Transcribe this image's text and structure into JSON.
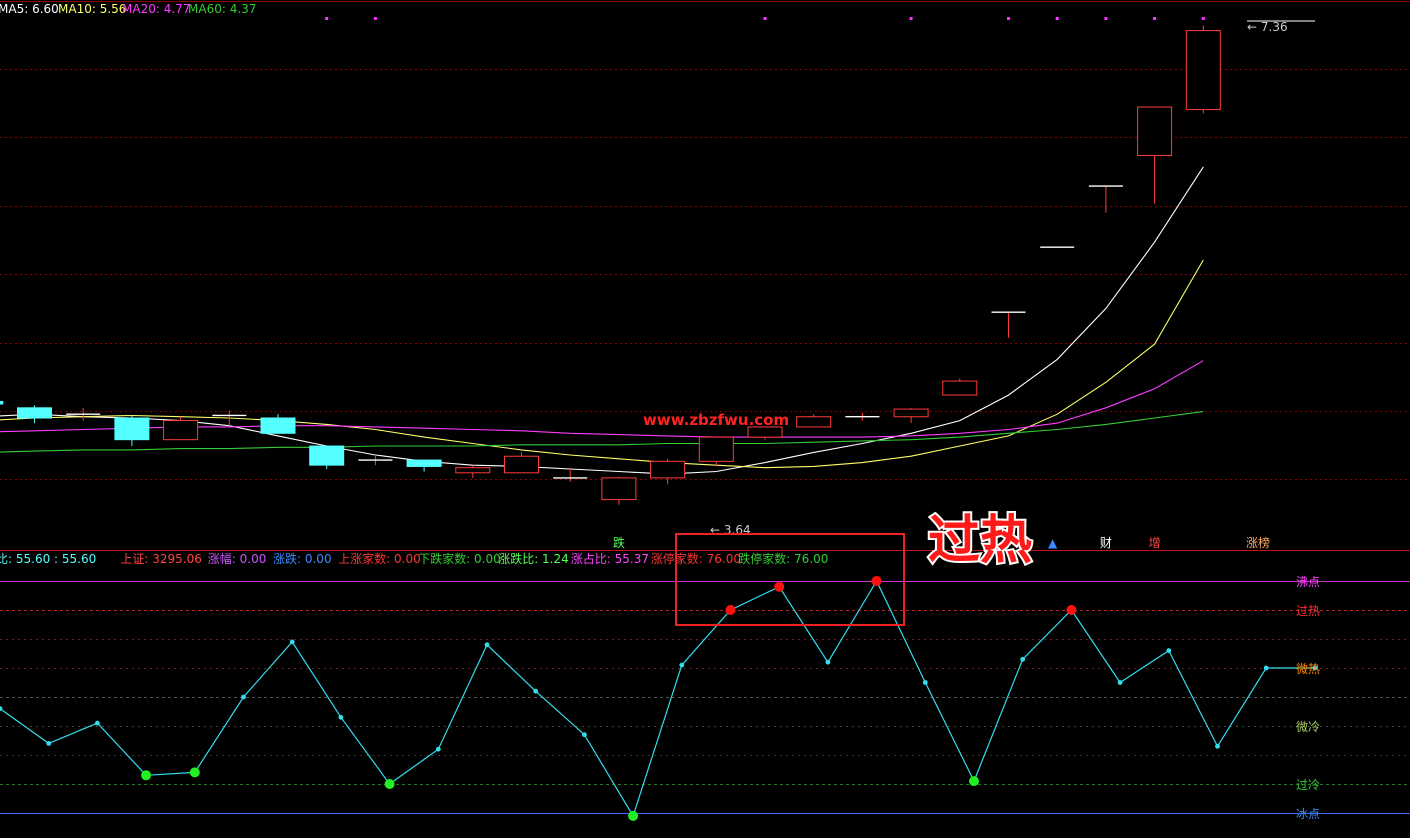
{
  "colors": {
    "background": "#000000",
    "up": "#ff3b3b",
    "down": "#54ffff",
    "ma5": "#ffffff",
    "ma10": "#ffff66",
    "ma20": "#ff3bff",
    "ma60": "#33cc33",
    "oscillator": "#33ddee",
    "hot_dot": "#ff1010",
    "cold_dot": "#22ee22",
    "grid": "#8b0000"
  },
  "top_legend": [
    {
      "label": "MA5:",
      "value": "6.60",
      "color": "#ffffff"
    },
    {
      "label": "MA10:",
      "value": "5.56",
      "color": "#ffff66"
    },
    {
      "label": "MA20:",
      "value": "4.77",
      "color": "#ff3bff"
    },
    {
      "label": "MA60:",
      "value": "4.37",
      "color": "#33cc33"
    }
  ],
  "watermark": "www.zbzfwu.com",
  "callout": "过热",
  "bottom_legend": [
    {
      "text": "比: 55.60 : 55.60",
      "color": "#54ffff"
    },
    {
      "text": "上证: 3295.06",
      "color": "#ff4444"
    },
    {
      "text": "涨幅: 0.00",
      "color": "#cc55ff"
    },
    {
      "text": "涨跌: 0.00",
      "color": "#3b8bff"
    },
    {
      "text": "上涨家数: 0.00",
      "color": "#ff3333"
    },
    {
      "text": "下跌家数: 0.00",
      "color": "#33cc33"
    },
    {
      "text": "涨跌比: 1.24",
      "color": "#55ff55"
    },
    {
      "text": "涨占比: 55.37",
      "color": "#ff44ff"
    },
    {
      "text": "涨停家数: 76.00",
      "color": "#ff3333"
    },
    {
      "text": "跌停家数: 76.00",
      "color": "#33cc33"
    }
  ],
  "signal_labels": [
    {
      "text": "跌",
      "index": 12,
      "color": "#55ff55"
    },
    {
      "text": "财",
      "index": 22,
      "color": "#ffffff"
    },
    {
      "text": "增",
      "index": 23,
      "color": "#ff4444"
    },
    {
      "text": "涨榜",
      "index": 25,
      "color": "#ffaa66"
    }
  ],
  "level_labels": [
    {
      "text": "沸点",
      "value": 100,
      "color": "#ff44ff"
    },
    {
      "text": "过热",
      "value": 90,
      "color": "#ff3333"
    },
    {
      "text": "微热",
      "value": 70,
      "color": "#ff8800"
    },
    {
      "text": "微冷",
      "value": 50,
      "color": "#aacc66"
    },
    {
      "text": "过冷",
      "value": 30,
      "color": "#33cc33"
    },
    {
      "text": "冰点",
      "value": 20,
      "color": "#3b8bff"
    }
  ],
  "chart_data": [
    {
      "type": "candlestick",
      "title": "",
      "ylim": [
        3.3,
        7.6
      ],
      "price_labels": {
        "high": "7.36",
        "low": "3.64"
      },
      "x": [
        1,
        2,
        3,
        4,
        5,
        6,
        7,
        8,
        9,
        10,
        11,
        12,
        13,
        14,
        15,
        16,
        17,
        18,
        19,
        20,
        21,
        22,
        23,
        24,
        25
      ],
      "candles": [
        {
          "o": 4.45,
          "h": 4.46,
          "l": 4.42,
          "c": 4.43
        },
        {
          "o": 4.4,
          "h": 4.42,
          "l": 4.28,
          "c": 4.32
        },
        {
          "o": 4.35,
          "h": 4.4,
          "l": 4.3,
          "c": 4.35
        },
        {
          "o": 4.32,
          "h": 4.34,
          "l": 4.1,
          "c": 4.15
        },
        {
          "o": 4.15,
          "h": 4.33,
          "l": 4.15,
          "c": 4.3
        },
        {
          "o": 4.34,
          "h": 4.38,
          "l": 4.25,
          "c": 4.34
        },
        {
          "o": 4.32,
          "h": 4.35,
          "l": 4.2,
          "c": 4.2
        },
        {
          "o": 4.1,
          "h": 4.1,
          "l": 3.92,
          "c": 3.95
        },
        {
          "o": 3.99,
          "h": 4.03,
          "l": 3.95,
          "c": 3.99
        },
        {
          "o": 3.99,
          "h": 3.99,
          "l": 3.9,
          "c": 3.94
        },
        {
          "o": 3.89,
          "h": 3.95,
          "l": 3.85,
          "c": 3.93
        },
        {
          "o": 3.89,
          "h": 4.05,
          "l": 3.89,
          "c": 4.02
        },
        {
          "o": 3.85,
          "h": 3.92,
          "l": 3.82,
          "c": 3.85
        },
        {
          "o": 3.68,
          "h": 3.86,
          "l": 3.64,
          "c": 3.85
        },
        {
          "o": 3.85,
          "h": 4.0,
          "l": 3.8,
          "c": 3.98
        },
        {
          "o": 3.98,
          "h": 4.17,
          "l": 3.94,
          "c": 4.17
        },
        {
          "o": 4.17,
          "h": 4.25,
          "l": 4.15,
          "c": 4.25
        },
        {
          "o": 4.25,
          "h": 4.35,
          "l": 4.25,
          "c": 4.33
        },
        {
          "o": 4.33,
          "h": 4.36,
          "l": 4.3,
          "c": 4.33
        },
        {
          "o": 4.33,
          "h": 4.4,
          "l": 4.28,
          "c": 4.39
        },
        {
          "o": 4.5,
          "h": 4.63,
          "l": 4.5,
          "c": 4.61
        },
        {
          "o": 5.15,
          "h": 5.15,
          "l": 4.95,
          "c": 5.15
        },
        {
          "o": 5.66,
          "h": 5.66,
          "l": 5.66,
          "c": 5.66
        },
        {
          "o": 6.14,
          "h": 6.14,
          "l": 5.93,
          "c": 6.14
        },
        {
          "o": 6.38,
          "h": 6.76,
          "l": 6.0,
          "c": 6.76
        },
        {
          "o": 6.74,
          "h": 7.4,
          "l": 6.71,
          "c": 7.36
        }
      ],
      "series": [
        {
          "name": "MA5",
          "values": [
            4.33,
            4.35,
            4.33,
            4.32,
            4.3,
            4.26,
            4.18,
            4.1,
            4.03,
            3.98,
            3.95,
            3.94,
            3.92,
            3.9,
            3.88,
            3.9,
            3.97,
            4.05,
            4.12,
            4.2,
            4.3,
            4.5,
            4.78,
            5.18,
            5.7,
            6.29
          ]
        },
        {
          "name": "MA10",
          "values": [
            4.3,
            4.32,
            4.33,
            4.34,
            4.33,
            4.32,
            4.3,
            4.27,
            4.23,
            4.17,
            4.12,
            4.07,
            4.03,
            4.0,
            3.97,
            3.95,
            3.93,
            3.94,
            3.97,
            4.02,
            4.1,
            4.18,
            4.35,
            4.6,
            4.9,
            5.56
          ]
        },
        {
          "name": "MA20",
          "values": [
            4.21,
            4.22,
            4.23,
            4.24,
            4.25,
            4.25,
            4.26,
            4.26,
            4.25,
            4.24,
            4.23,
            4.22,
            4.2,
            4.19,
            4.18,
            4.17,
            4.17,
            4.17,
            4.17,
            4.18,
            4.2,
            4.23,
            4.28,
            4.4,
            4.55,
            4.77
          ]
        },
        {
          "name": "MA60",
          "values": [
            4.05,
            4.06,
            4.07,
            4.07,
            4.08,
            4.08,
            4.09,
            4.09,
            4.1,
            4.1,
            4.1,
            4.11,
            4.11,
            4.11,
            4.12,
            4.12,
            4.12,
            4.13,
            4.14,
            4.15,
            4.17,
            4.2,
            4.23,
            4.27,
            4.32,
            4.37
          ]
        }
      ]
    },
    {
      "type": "line",
      "title": "",
      "ylim": [
        19,
        109
      ],
      "x": [
        0,
        1,
        2,
        3,
        4,
        5,
        6,
        7,
        8,
        9,
        10,
        11,
        12,
        13,
        14,
        15,
        16,
        17,
        18,
        19,
        20,
        21,
        22,
        23,
        24,
        25,
        26,
        27
      ],
      "values": [
        56,
        44,
        51,
        33,
        34,
        60,
        79,
        53,
        30,
        42,
        78,
        62,
        47,
        19,
        71,
        90,
        98,
        72,
        100,
        65,
        31,
        73,
        90,
        65,
        76,
        43,
        70,
        70
      ],
      "levels": [
        20,
        30,
        40,
        50,
        60,
        70,
        80,
        90,
        100
      ]
    }
  ]
}
